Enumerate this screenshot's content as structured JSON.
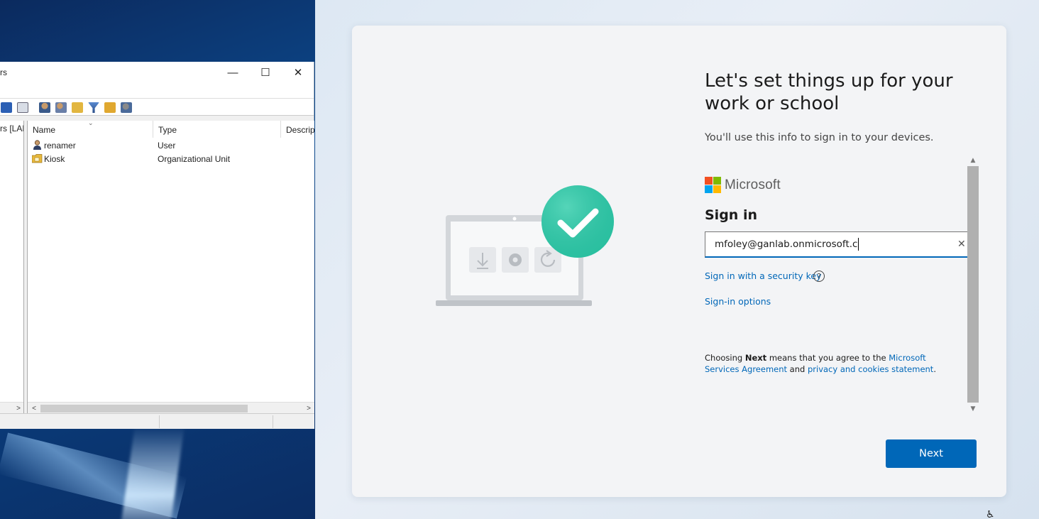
{
  "aduc": {
    "title_fragment": "rs",
    "tree_label": "rs [LAB",
    "columns": [
      "Name",
      "Type",
      "Descript"
    ],
    "rows": [
      {
        "name": "renamer",
        "type": "User",
        "icon": "user-icon"
      },
      {
        "name": "Kiosk",
        "type": "Organizational Unit",
        "icon": "ou-folder-icon"
      }
    ],
    "window_controls": {
      "minimize": "—",
      "maximize": "☐",
      "close": "✕"
    }
  },
  "oobe": {
    "title": "Let's set things up for your work or school",
    "subtitle": "You'll use this info to sign in to your devices.",
    "brand": "Microsoft",
    "signin_heading": "Sign in",
    "email_value": "mfoley@ganlab.onmicrosoft.c",
    "clear_glyph": "✕",
    "security_key_link": "Sign in with a security key",
    "help_glyph": "?",
    "signin_options_link": "Sign-in options",
    "agreement": {
      "prefix": "Choosing ",
      "bold": "Next",
      "middle": " means that you agree to the ",
      "link1": "Microsoft Services Agreement",
      "and": " and ",
      "link2": "privacy and cookies statement",
      "end": "."
    },
    "next_button": "Next",
    "accessibility_glyph": "♿"
  },
  "colors": {
    "accent": "#0067b8",
    "check_green": "#2ec5a5",
    "ms_red": "#f25022",
    "ms_green": "#7fba00",
    "ms_blue": "#00a4ef",
    "ms_yellow": "#ffb900"
  }
}
